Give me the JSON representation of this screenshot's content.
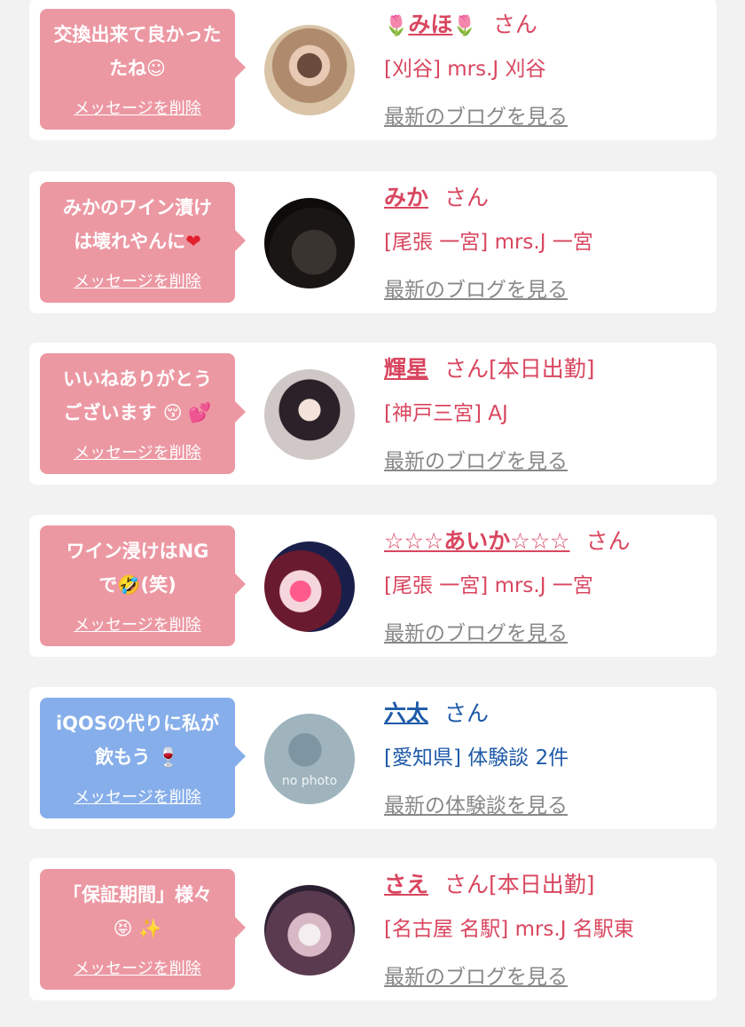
{
  "colors": {
    "bubble_pink": "#ec98a3",
    "bubble_blue": "#86aeea",
    "name_pink": "#d9465f",
    "name_blue": "#1e5aa8",
    "link_gray": "#888888",
    "background": "#f2f2f2"
  },
  "messages": [
    {
      "message": "交換出来て良かった",
      "message_line2": "たね",
      "emoji": "☺",
      "delete_label": "メッセージを削除",
      "name_prefix_icon": "🌷",
      "name": "みほ",
      "name_suffix_icon": "🌷",
      "honorific": "さん",
      "status": "",
      "shop": "[刈谷] mrs.J 刈谷",
      "link": "最新のブログを見る",
      "avatar_icon": "avatar-photo"
    },
    {
      "message": "みかのワイン漬け",
      "message_line2": "は壊れやんに",
      "emoji": "❤",
      "delete_label": "メッセージを削除",
      "name": "みか",
      "honorific": "さん",
      "status": "",
      "shop": "[尾張 一宮] mrs.J 一宮",
      "link": "最新のブログを見る",
      "avatar_icon": "avatar-photo"
    },
    {
      "message": "いいねありがとう",
      "message_line2": "ございます",
      "emoji": "😚 💕",
      "delete_label": "メッセージを削除",
      "name": "輝星",
      "honorific": "さん",
      "status": "[本日出勤]",
      "shop": "[神戸三宮] AJ",
      "link": "最新のブログを見る",
      "avatar_icon": "avatar-photo"
    },
    {
      "message": "ワイン浸けはNG",
      "message_line2": "で🤣(笑)",
      "emoji": "",
      "delete_label": "メッセージを削除",
      "name": "☆☆☆あいか☆☆☆",
      "honorific": "さん",
      "status": "",
      "shop": "[尾張 一宮] mrs.J 一宮",
      "link": "最新のブログを見る",
      "avatar_icon": "avatar-photo"
    },
    {
      "message": "iQOSの代りに私が",
      "message_line2": "飲もう",
      "emoji": "🍷",
      "delete_label": "メッセージを削除",
      "name": "六太",
      "honorific": "さん",
      "status": "",
      "shop": "[愛知県] 体験談 2件",
      "link": "最新の体験談を見る",
      "avatar_icon": "no-photo-avatar",
      "avatar_text": "no photo"
    },
    {
      "message": "「保証期間」様々",
      "message_line2": "",
      "emoji": "😝 ✨",
      "delete_label": "メッセージを削除",
      "name": "さえ",
      "honorific": "さん",
      "status": "[本日出勤]",
      "shop": "[名古屋 名駅] mrs.J 名駅東",
      "link": "最新のブログを見る",
      "avatar_icon": "avatar-photo"
    }
  ]
}
